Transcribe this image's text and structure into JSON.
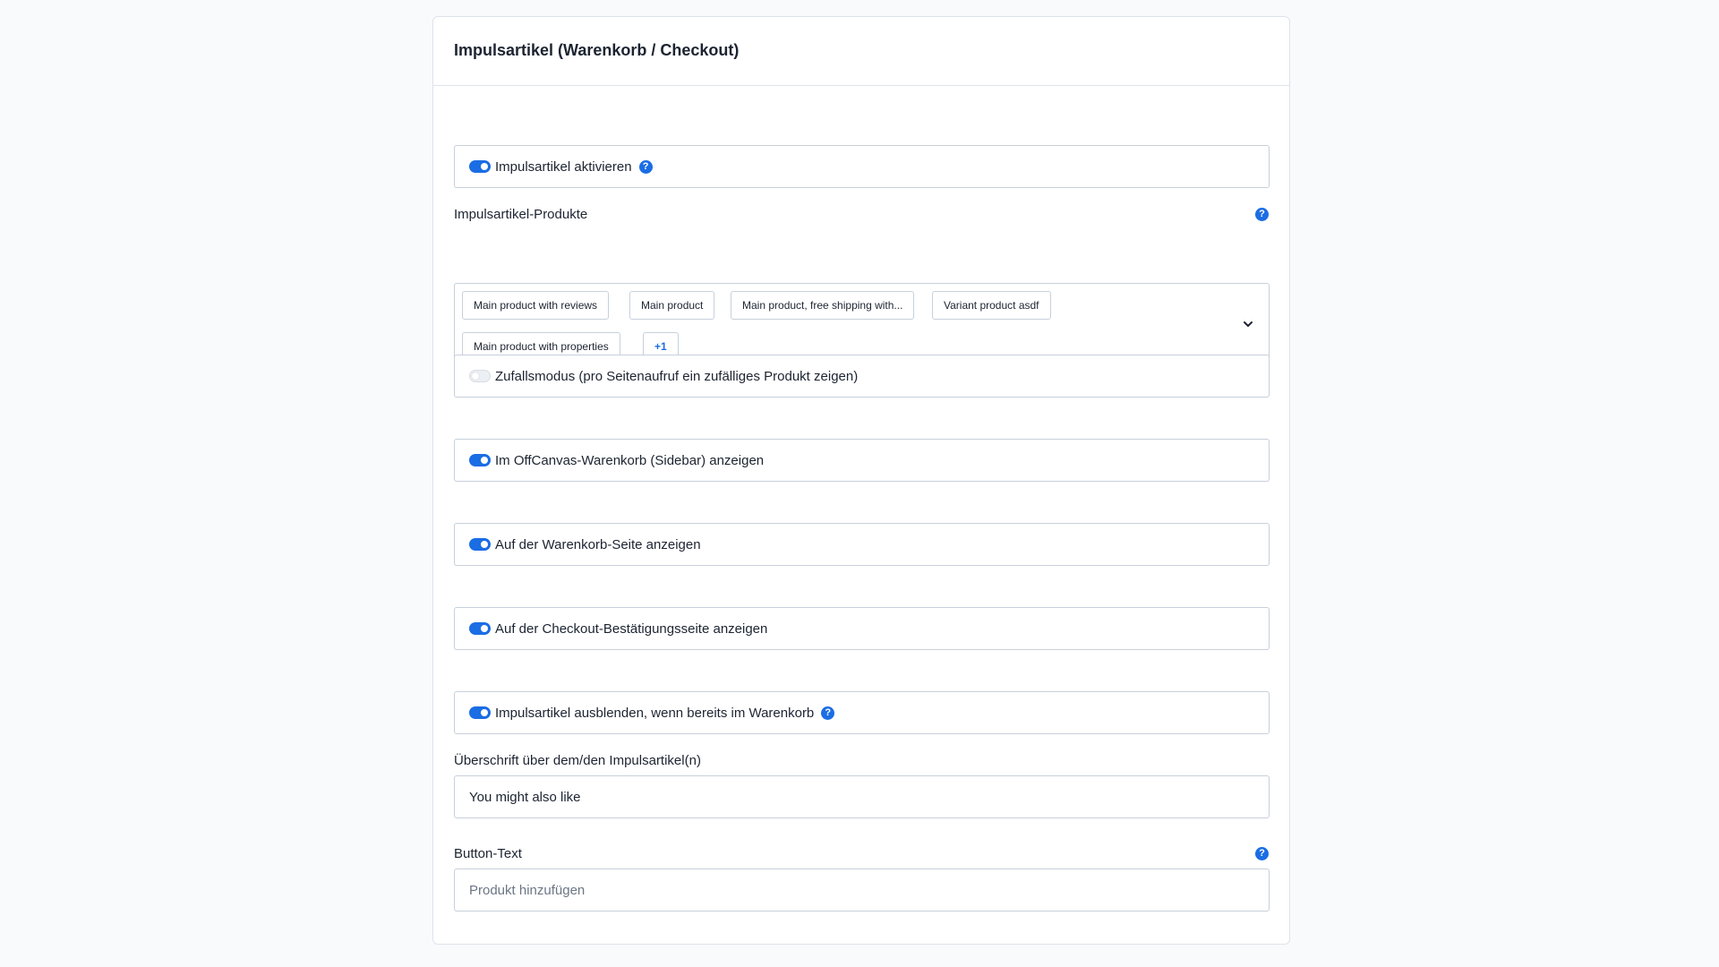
{
  "card": {
    "title": "Impulsartikel (Warenkorb / Checkout)"
  },
  "toggles": {
    "activate": {
      "label": "Impulsartikel aktivieren",
      "on": true
    },
    "random": {
      "label": "Zufallsmodus (pro Seitenaufruf ein zufälliges Produkt zeigen)",
      "on": false
    },
    "offcanvas": {
      "label": "Im OffCanvas-Warenkorb (Sidebar) anzeigen",
      "on": true
    },
    "cart_page": {
      "label": "Auf der Warenkorb-Seite anzeigen",
      "on": true
    },
    "checkout_confirm": {
      "label": "Auf der Checkout-Bestätigungsseite anzeigen",
      "on": true
    },
    "hide_in_cart": {
      "label": "Impulsartikel ausblenden, wenn bereits im Warenkorb",
      "on": true
    }
  },
  "products": {
    "label": "Impulsartikel-Produkte",
    "chips": [
      "Main product with reviews",
      "Main product",
      "Main product, free shipping with...",
      "Variant product asdf",
      "Main product with properties"
    ],
    "more": "+1"
  },
  "heading_field": {
    "label": "Überschrift über dem/den Impulsartikel(n)",
    "value": "You might also like"
  },
  "button_text_field": {
    "label": "Button-Text",
    "placeholder": "Produkt hinzufügen"
  },
  "help_glyph": "?",
  "icons": {
    "help": "help-circle-icon",
    "chevron": "chevron-down-icon"
  },
  "colors": {
    "accent": "#1b6de4",
    "border": "#c7d0db",
    "background": "#f9fafc"
  }
}
